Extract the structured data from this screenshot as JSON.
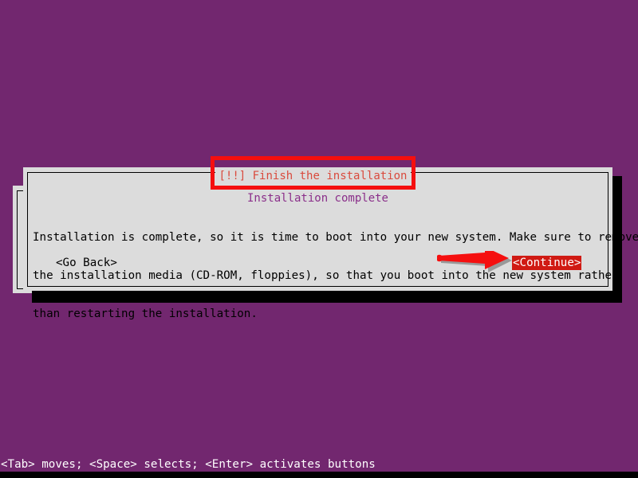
{
  "screen": {
    "background_color": "#72276f",
    "accent_annotation_color": "#f50f0f"
  },
  "dialog": {
    "title": "[!!] Finish the installation",
    "title_color": "#d94a3d",
    "subtitle": "Installation complete",
    "subtitle_color": "#8a2f8a",
    "background_color": "#dcdcdc",
    "body_lines": [
      "Installation is complete, so it is time to boot into your new system. Make sure to remove",
      "the installation media (CD-ROM, floppies), so that you boot into the new system rather",
      "than restarting the installation."
    ],
    "buttons": {
      "go_back": "<Go Back>",
      "continue": "<Continue>",
      "continue_selected_color": "#d01a13"
    }
  },
  "annotations": {
    "title_box": "red-rectangle-highlight",
    "arrow": "red-right-arrow"
  },
  "help_bar": {
    "text": "<Tab> moves; <Space> selects; <Enter> activates buttons"
  }
}
